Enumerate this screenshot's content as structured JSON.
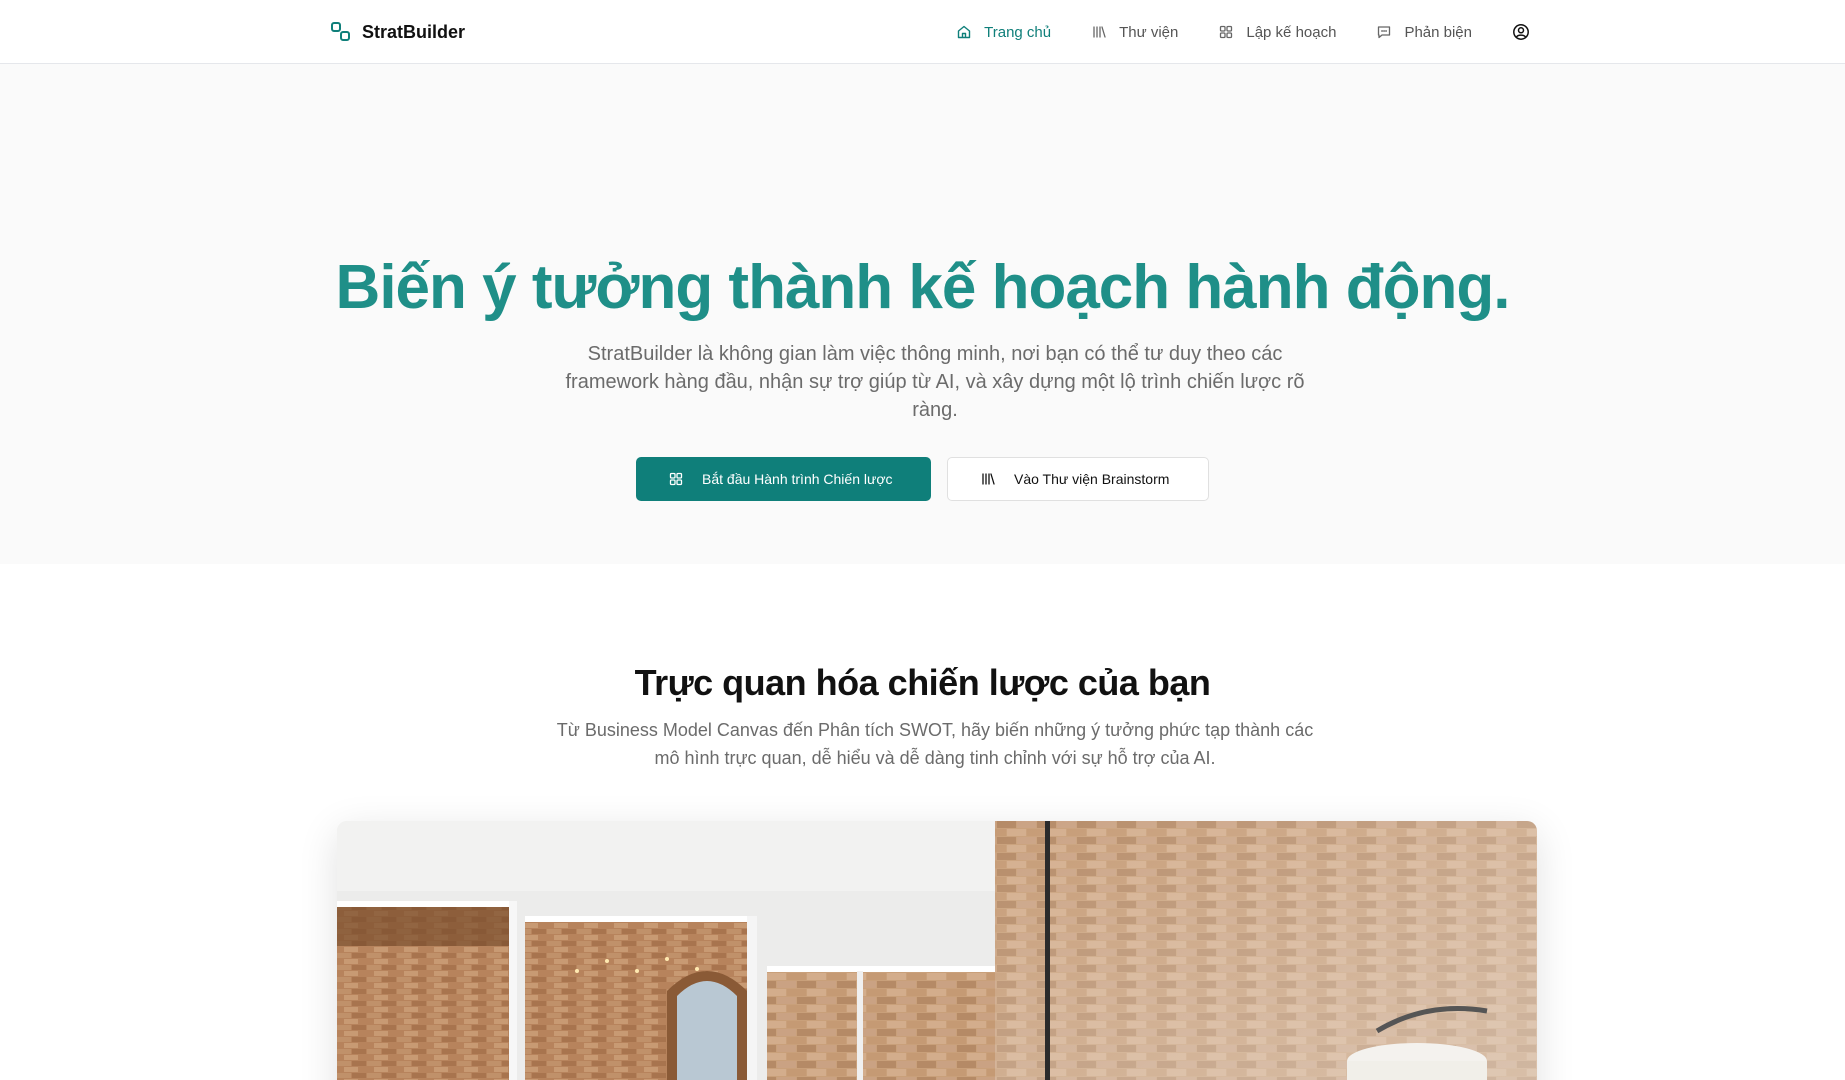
{
  "brand": {
    "name": "StratBuilder",
    "logo_icon": "linked-squares-icon"
  },
  "nav": {
    "items": [
      {
        "label": "Trang chủ",
        "icon": "home-icon",
        "active": true
      },
      {
        "label": "Thư viện",
        "icon": "library-icon",
        "active": false
      },
      {
        "label": "Lập kế hoạch",
        "icon": "grid-icon",
        "active": false
      },
      {
        "label": "Phản biện",
        "icon": "message-icon",
        "active": false
      }
    ],
    "user_icon": "user-circle-icon"
  },
  "hero": {
    "title": "Biến ý tưởng thành kế hoạch hành động.",
    "description": "StratBuilder là không gian làm việc thông minh, nơi bạn có thể tư duy theo các framework hàng đầu, nhận sự trợ giúp từ AI, và xây dựng một lộ trình chiến lược rõ ràng.",
    "primary_button": "Bắt đầu Hành trình Chiến lược",
    "secondary_button": "Vào Thư viện Brainstorm"
  },
  "section": {
    "title": "Trực quan hóa chiến lược của bạn",
    "description": "Từ Business Model Canvas đến Phân tích SWOT, hãy biến những ý tưởng phức tạp thành các mô hình trực quan, dễ hiểu và dễ dàng tinh chỉnh với sự hỗ trợ của AI."
  },
  "colors": {
    "accent": "#0f7f7a",
    "title": "#1f8f88",
    "hero_bg": "#fafafa"
  }
}
